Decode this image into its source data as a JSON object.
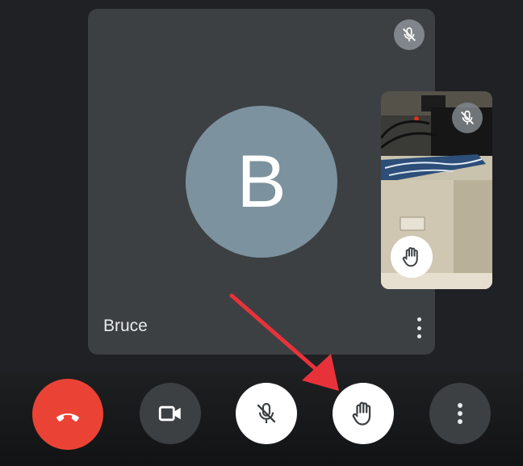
{
  "participant": {
    "name": "Bruce",
    "avatar_letter": "B",
    "avatar_color": "#7c929e",
    "muted": true,
    "mute_icon": "mic-off-icon",
    "more_icon": "more-vert-icon"
  },
  "self_view": {
    "muted": true,
    "hand_raised": true,
    "mute_icon": "mic-off-icon",
    "hand_icon": "raise-hand-icon"
  },
  "controls": [
    {
      "id": "end",
      "icon": "call-end-icon",
      "color": "#ea4335"
    },
    {
      "id": "camera",
      "icon": "video-camera-icon",
      "color": "#3c4043"
    },
    {
      "id": "mic",
      "icon": "mic-off-icon",
      "color": "#ffffff"
    },
    {
      "id": "hand",
      "icon": "raise-hand-icon",
      "color": "#ffffff"
    },
    {
      "id": "more",
      "icon": "more-vert-icon",
      "color": "#3c4043"
    }
  ],
  "annotation": {
    "icon": "red-arrow",
    "color": "#e8323a",
    "points_to": "hand"
  }
}
